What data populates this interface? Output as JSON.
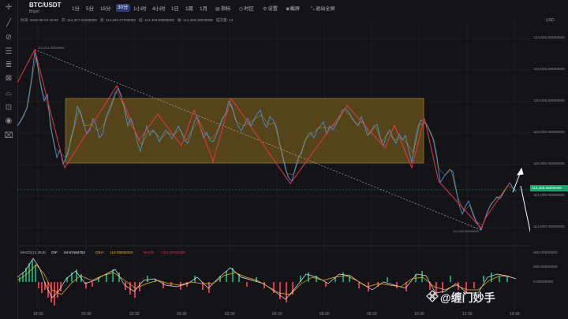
{
  "header": {
    "pair": "BTC/USDT",
    "exchange": "Bitget",
    "intervals": [
      "1分",
      "5分",
      "15分",
      "30分",
      "1小时",
      "4小时",
      "1日",
      "1周",
      "1月"
    ],
    "active_interval": "30分",
    "tools": [
      {
        "icon": "indicator-icon",
        "label": "指标"
      },
      {
        "icon": "time-zone-icon",
        "label": "时区"
      },
      {
        "icon": "settings-icon",
        "label": "设置"
      },
      {
        "icon": "camera-icon",
        "label": "截屏"
      },
      {
        "icon": "fullscreen-exit-icon",
        "label": "退出全屏"
      }
    ]
  },
  "ohlc": {
    "time_label": "时间:",
    "time": "2025-08-04 15:00",
    "open_label": "开:",
    "open": "114,427.01000000",
    "high_label": "高:",
    "high": "114,491.07000000",
    "low_label": "低:",
    "low": "114,403.00000000",
    "close_label": "收:",
    "close": "114,469.25000000",
    "volume_label": "成交量:",
    "volume": "13"
  },
  "price_axis": {
    "currency": "USD",
    "ticks": [
      "124,000.00000000",
      "122,000.00000000",
      "120,000.00000000",
      "118,000.00000000",
      "116,000.00000000",
      "114,000.00000000",
      "112,000.00000000"
    ],
    "current_price": "114,469.25000000"
  },
  "annotations": {
    "high_point": "123,214.52000000",
    "low_point": "111,918.00000000"
  },
  "macd": {
    "title": "MACD(12,26,9)",
    "dif_label": "DIF:",
    "dif": "64.67464762",
    "dea_label": "DEA:",
    "dea": "116.05836453",
    "macd_label": "MACD:",
    "macd": "-102.76743380",
    "ticks": [
      "800.00000000",
      "600.00000000",
      "0.00000000"
    ]
  },
  "time_axis": [
    "18:30",
    "20:30",
    "22:30",
    "00:30",
    "02:30",
    "04:30",
    "06:30",
    "08:30",
    "10:30",
    "12:30",
    "14:30"
  ],
  "watermark": {
    "text": "@缠门妙手"
  },
  "colors": {
    "background": "#141418",
    "up": "#4a90d9",
    "down": "#e0394a",
    "box_fill": "#8a6a1e",
    "current_price": "#1aa06a",
    "dif_line": "#e8e8ec",
    "dea_line": "#f0b429"
  }
}
